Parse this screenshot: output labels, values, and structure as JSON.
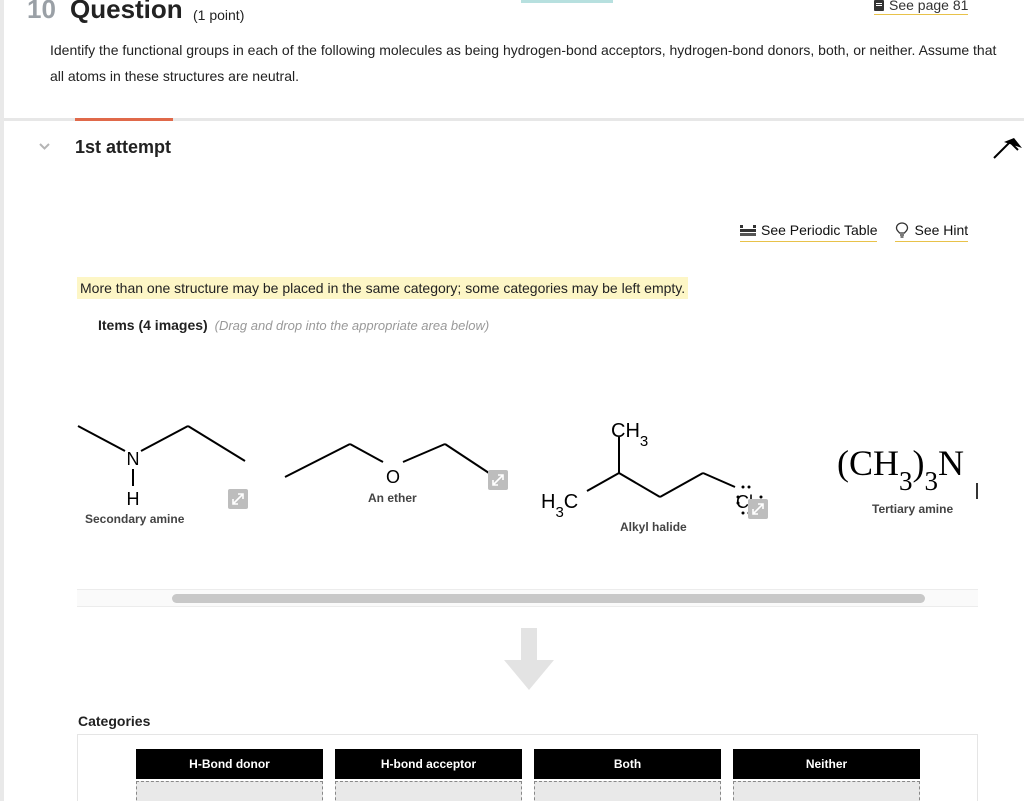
{
  "header": {
    "number": "10",
    "title": "Question",
    "points": "(1 point)",
    "see_page": "See page 81",
    "prompt": "Identify the functional groups in each of the following molecules as being hydrogen-bond acceptors, hydrogen-bond donors, both, or neither. Assume that all atoms in these structures are neutral."
  },
  "attempt": {
    "label": "1st attempt"
  },
  "tools": {
    "periodic_table": "See Periodic Table",
    "hint": "See Hint"
  },
  "note": "More than one structure may be placed in the same category; some categories may be left empty.",
  "items_section": {
    "title": "Items (4 images)",
    "hint": "(Drag and drop into the appropriate area below)"
  },
  "items": [
    {
      "label": "Secondary amine",
      "atoms": {
        "n": "N",
        "h": "H"
      }
    },
    {
      "label": "An ether",
      "atoms": {
        "o": "O"
      }
    },
    {
      "label": "Alkyl halide",
      "atoms": {
        "ch3": "CH3",
        "h3c": "H3C",
        "cl": "Cl"
      }
    },
    {
      "label": "Tertiary amine",
      "atoms": {
        "formula": "(CH3)3N"
      }
    }
  ],
  "categories": {
    "title": "Categories",
    "list": [
      "H-Bond donor",
      "H-bond acceptor",
      "Both",
      "Neither"
    ]
  },
  "icons": [
    "book-icon",
    "chevron-down-icon",
    "cursor-arrow-icon",
    "periodic-table-icon",
    "lightbulb-icon",
    "expand-icon",
    "down-arrow-icon"
  ],
  "colors": {
    "accent_orange": "#e0694a",
    "highlight_yellow": "#fdf6c6",
    "link_underline": "#e8c24a",
    "category_header": "#000000"
  }
}
